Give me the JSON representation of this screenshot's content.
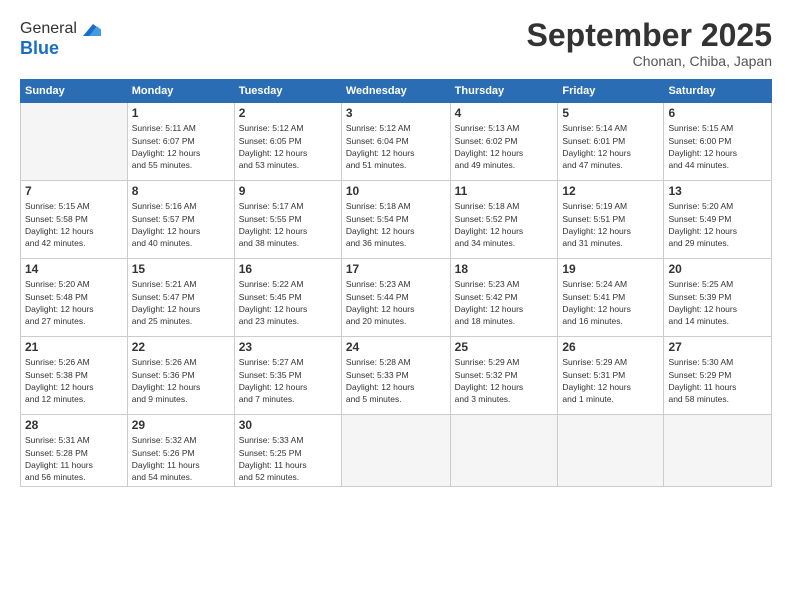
{
  "logo": {
    "general": "General",
    "blue": "Blue"
  },
  "header": {
    "month": "September 2025",
    "location": "Chonan, Chiba, Japan"
  },
  "weekdays": [
    "Sunday",
    "Monday",
    "Tuesday",
    "Wednesday",
    "Thursday",
    "Friday",
    "Saturday"
  ],
  "weeks": [
    [
      {
        "day": "",
        "empty": true
      },
      {
        "day": "1",
        "sunrise": "5:11 AM",
        "sunset": "6:07 PM",
        "daylight": "12 hours and 55 minutes."
      },
      {
        "day": "2",
        "sunrise": "5:12 AM",
        "sunset": "6:05 PM",
        "daylight": "12 hours and 53 minutes."
      },
      {
        "day": "3",
        "sunrise": "5:12 AM",
        "sunset": "6:04 PM",
        "daylight": "12 hours and 51 minutes."
      },
      {
        "day": "4",
        "sunrise": "5:13 AM",
        "sunset": "6:02 PM",
        "daylight": "12 hours and 49 minutes."
      },
      {
        "day": "5",
        "sunrise": "5:14 AM",
        "sunset": "6:01 PM",
        "daylight": "12 hours and 47 minutes."
      },
      {
        "day": "6",
        "sunrise": "5:15 AM",
        "sunset": "6:00 PM",
        "daylight": "12 hours and 44 minutes."
      }
    ],
    [
      {
        "day": "7",
        "sunrise": "5:15 AM",
        "sunset": "5:58 PM",
        "daylight": "12 hours and 42 minutes."
      },
      {
        "day": "8",
        "sunrise": "5:16 AM",
        "sunset": "5:57 PM",
        "daylight": "12 hours and 40 minutes."
      },
      {
        "day": "9",
        "sunrise": "5:17 AM",
        "sunset": "5:55 PM",
        "daylight": "12 hours and 38 minutes."
      },
      {
        "day": "10",
        "sunrise": "5:18 AM",
        "sunset": "5:54 PM",
        "daylight": "12 hours and 36 minutes."
      },
      {
        "day": "11",
        "sunrise": "5:18 AM",
        "sunset": "5:52 PM",
        "daylight": "12 hours and 34 minutes."
      },
      {
        "day": "12",
        "sunrise": "5:19 AM",
        "sunset": "5:51 PM",
        "daylight": "12 hours and 31 minutes."
      },
      {
        "day": "13",
        "sunrise": "5:20 AM",
        "sunset": "5:49 PM",
        "daylight": "12 hours and 29 minutes."
      }
    ],
    [
      {
        "day": "14",
        "sunrise": "5:20 AM",
        "sunset": "5:48 PM",
        "daylight": "12 hours and 27 minutes."
      },
      {
        "day": "15",
        "sunrise": "5:21 AM",
        "sunset": "5:47 PM",
        "daylight": "12 hours and 25 minutes."
      },
      {
        "day": "16",
        "sunrise": "5:22 AM",
        "sunset": "5:45 PM",
        "daylight": "12 hours and 23 minutes."
      },
      {
        "day": "17",
        "sunrise": "5:23 AM",
        "sunset": "5:44 PM",
        "daylight": "12 hours and 20 minutes."
      },
      {
        "day": "18",
        "sunrise": "5:23 AM",
        "sunset": "5:42 PM",
        "daylight": "12 hours and 18 minutes."
      },
      {
        "day": "19",
        "sunrise": "5:24 AM",
        "sunset": "5:41 PM",
        "daylight": "12 hours and 16 minutes."
      },
      {
        "day": "20",
        "sunrise": "5:25 AM",
        "sunset": "5:39 PM",
        "daylight": "12 hours and 14 minutes."
      }
    ],
    [
      {
        "day": "21",
        "sunrise": "5:26 AM",
        "sunset": "5:38 PM",
        "daylight": "12 hours and 12 minutes."
      },
      {
        "day": "22",
        "sunrise": "5:26 AM",
        "sunset": "5:36 PM",
        "daylight": "12 hours and 9 minutes."
      },
      {
        "day": "23",
        "sunrise": "5:27 AM",
        "sunset": "5:35 PM",
        "daylight": "12 hours and 7 minutes."
      },
      {
        "day": "24",
        "sunrise": "5:28 AM",
        "sunset": "5:33 PM",
        "daylight": "12 hours and 5 minutes."
      },
      {
        "day": "25",
        "sunrise": "5:29 AM",
        "sunset": "5:32 PM",
        "daylight": "12 hours and 3 minutes."
      },
      {
        "day": "26",
        "sunrise": "5:29 AM",
        "sunset": "5:31 PM",
        "daylight": "12 hours and 1 minute."
      },
      {
        "day": "27",
        "sunrise": "5:30 AM",
        "sunset": "5:29 PM",
        "daylight": "11 hours and 58 minutes."
      }
    ],
    [
      {
        "day": "28",
        "sunrise": "5:31 AM",
        "sunset": "5:28 PM",
        "daylight": "11 hours and 56 minutes."
      },
      {
        "day": "29",
        "sunrise": "5:32 AM",
        "sunset": "5:26 PM",
        "daylight": "11 hours and 54 minutes."
      },
      {
        "day": "30",
        "sunrise": "5:33 AM",
        "sunset": "5:25 PM",
        "daylight": "11 hours and 52 minutes."
      },
      {
        "day": "",
        "empty": true
      },
      {
        "day": "",
        "empty": true
      },
      {
        "day": "",
        "empty": true
      },
      {
        "day": "",
        "empty": true
      }
    ]
  ]
}
